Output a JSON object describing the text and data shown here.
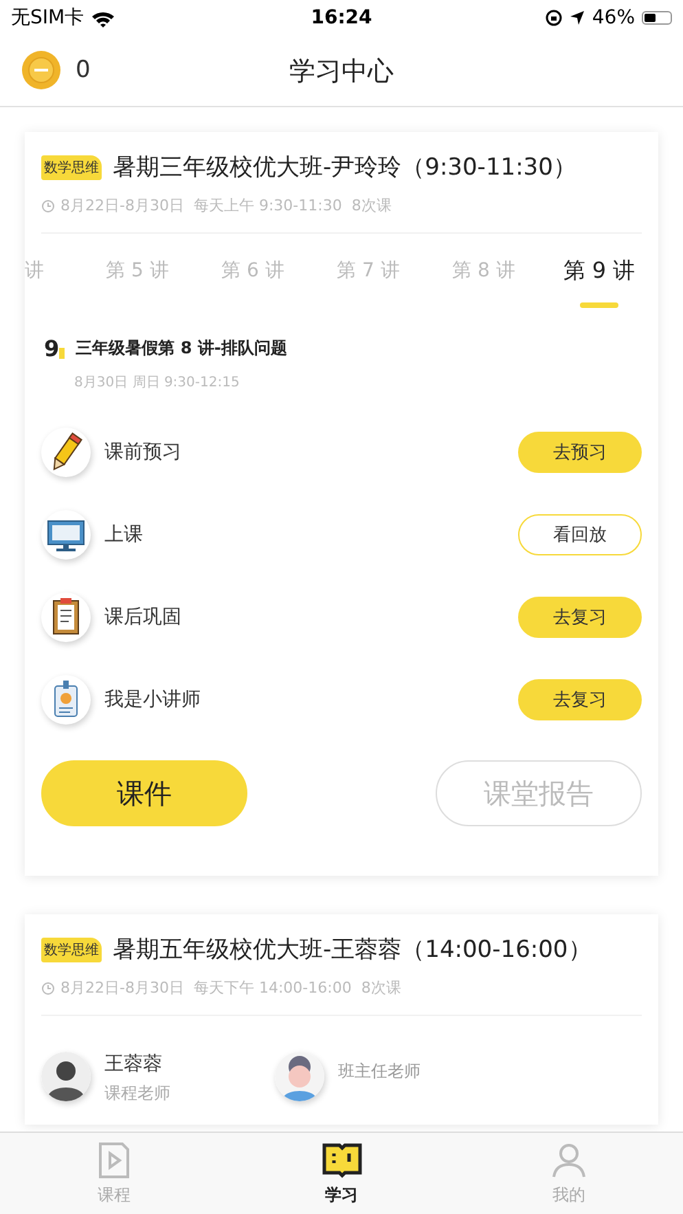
{
  "status_bar": {
    "carrier": "无SIM卡",
    "time": "16:24",
    "battery": "46%"
  },
  "header": {
    "coins": "0",
    "title": "学习中心"
  },
  "courses": [
    {
      "tag": "数学思维",
      "title": "暑期三年级校优大班-尹玲玲（9:30-11:30）",
      "schedule": "8月22日-8月30日  每天上午 9:30-11:30  8次课",
      "tabs": [
        {
          "label": "讲",
          "selected": false
        },
        {
          "label": "第 5 讲",
          "selected": false
        },
        {
          "label": "第 6 讲",
          "selected": false
        },
        {
          "label": "第 7 讲",
          "selected": false
        },
        {
          "label": "第 8 讲",
          "selected": false
        },
        {
          "label": "第 9 讲",
          "selected": true
        }
      ],
      "lesson": {
        "number": "9",
        "title": "三年级暑假第 8 讲-排队问题",
        "time": "8月30日 周日  9:30-12:15"
      },
      "tasks": [
        {
          "kind": "pencil",
          "label": "课前预习",
          "button": "去预习",
          "filled": true
        },
        {
          "kind": "monitor",
          "label": "上课",
          "button": "看回放",
          "filled": false
        },
        {
          "kind": "clipboard",
          "label": "课后巩固",
          "button": "去复习",
          "filled": true
        },
        {
          "kind": "badge",
          "label": "我是小讲师",
          "button": "去复习",
          "filled": true
        }
      ],
      "actions": [
        {
          "label": "课件",
          "disabled": false
        },
        {
          "label": "课堂报告",
          "disabled": true
        }
      ]
    },
    {
      "tag": "数学思维",
      "title": "暑期五年级校优大班-王蓉蓉（14:00-16:00）",
      "schedule": "8月22日-8月30日  每天下午 14:00-16:00  8次课",
      "teachers": [
        {
          "kind": "photo",
          "name": "王蓉蓉",
          "role": "课程老师"
        },
        {
          "kind": "cartoon",
          "name": "班主任老师"
        }
      ]
    }
  ],
  "tab_bar": [
    {
      "kind": "video",
      "label": "课程",
      "selected": false
    },
    {
      "kind": "book",
      "label": "学习",
      "selected": true
    },
    {
      "kind": "person",
      "label": "我的",
      "selected": false
    }
  ]
}
